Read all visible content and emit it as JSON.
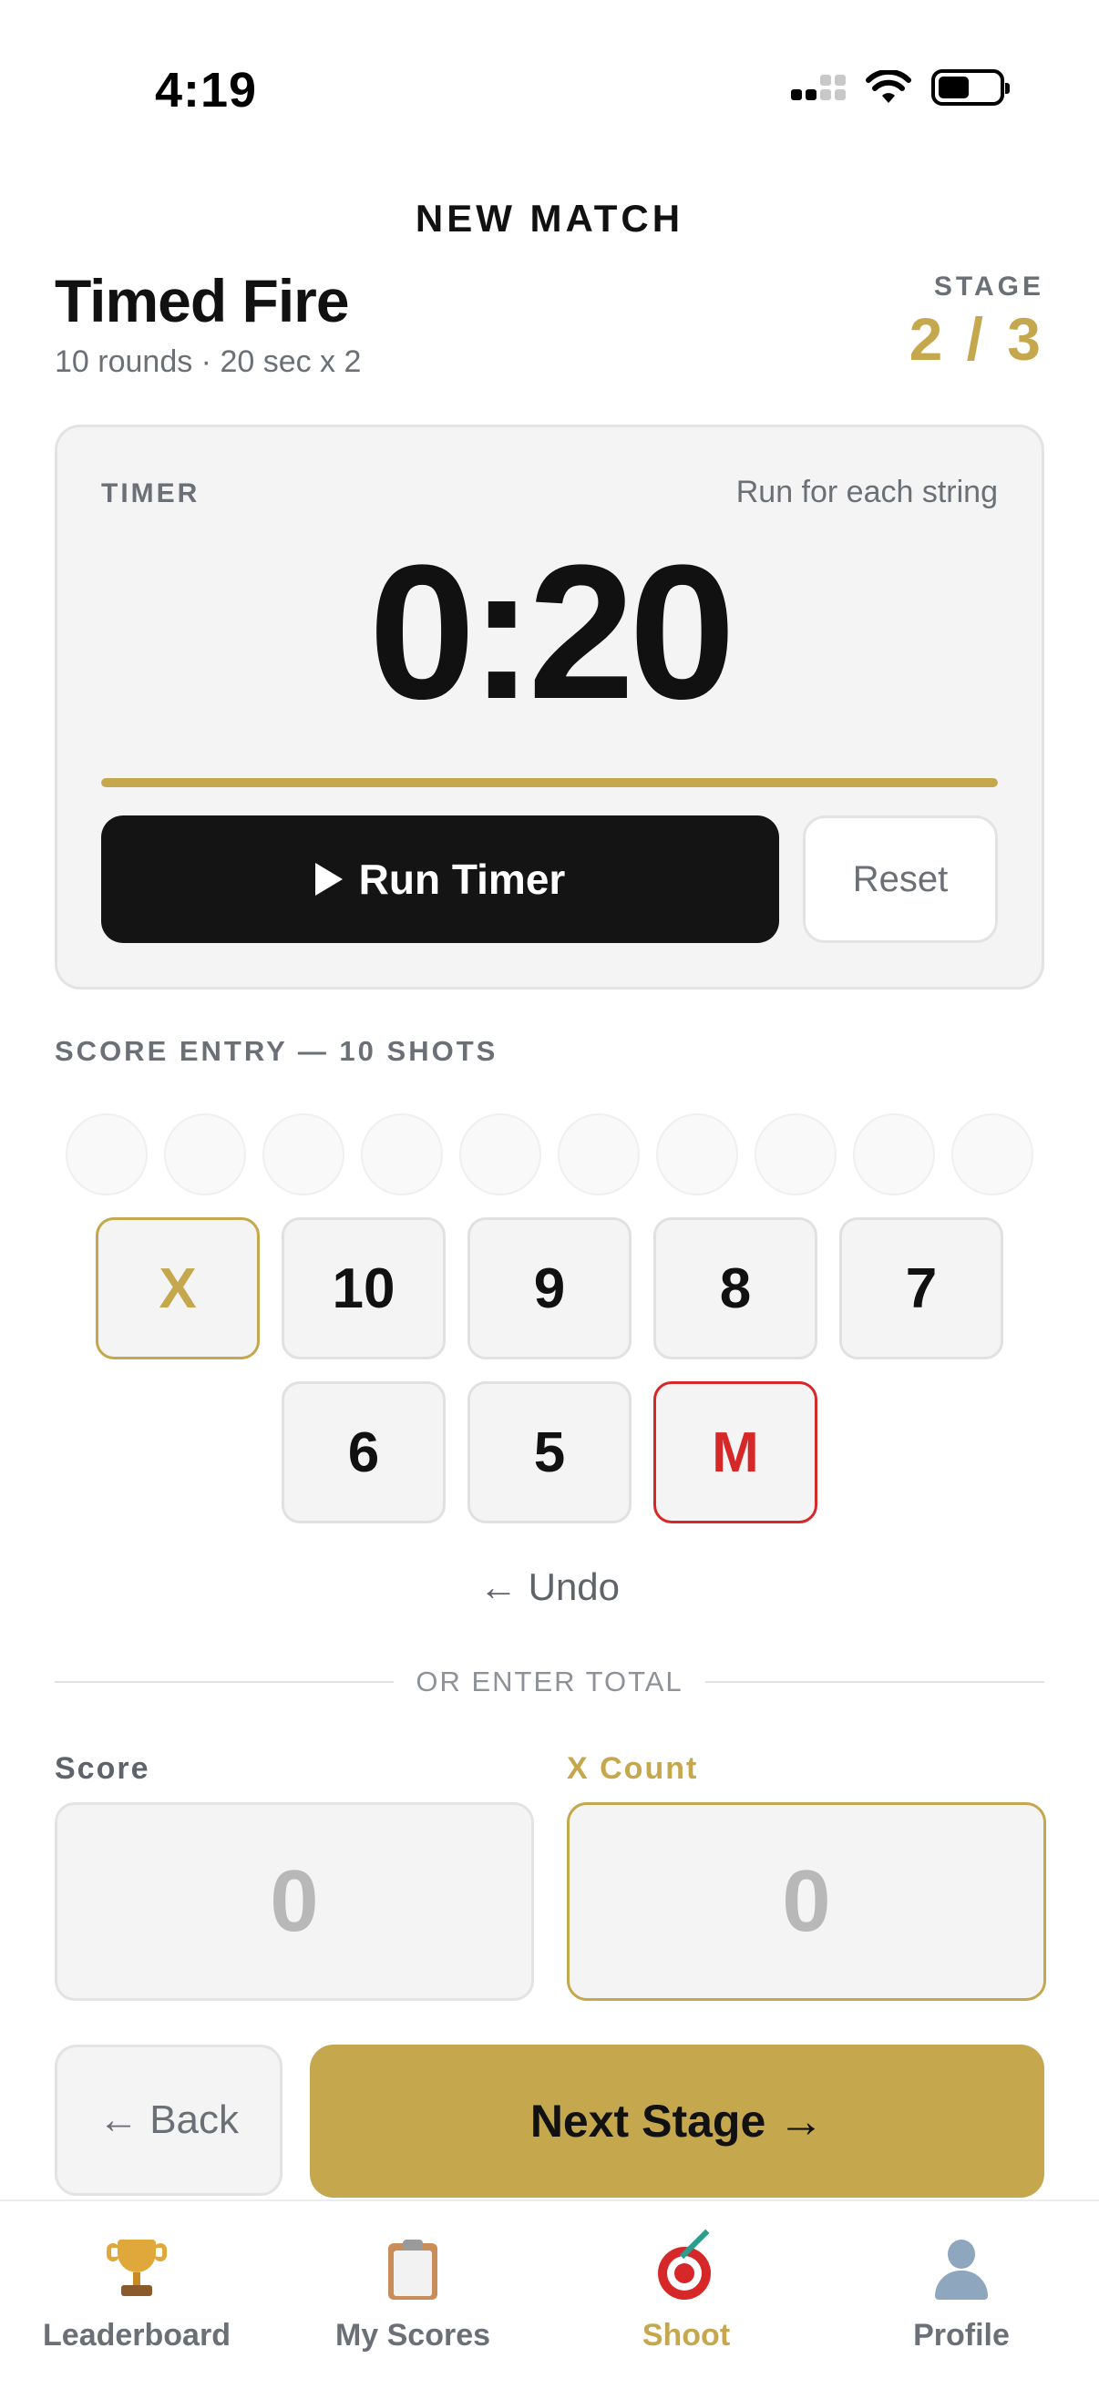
{
  "status_bar": {
    "time": "4:19"
  },
  "header": {
    "title": "NEW MATCH"
  },
  "stage": {
    "name": "Timed Fire",
    "subtitle": "10 rounds · 20 sec x 2",
    "label": "STAGE",
    "progress": "2 / 3"
  },
  "timer": {
    "label": "TIMER",
    "note": "Run for each string",
    "display": "0:20",
    "progress_fraction": 1.0,
    "run_label": "Run Timer",
    "reset_label": "Reset"
  },
  "score_entry": {
    "label": "SCORE ENTRY — 10 SHOTS",
    "shot_count": 10,
    "buttons": [
      "X",
      "10",
      "9",
      "8",
      "7",
      "6",
      "5",
      "M"
    ],
    "undo_label": "← Undo"
  },
  "total_entry": {
    "divider_label": "OR ENTER TOTAL",
    "score_label": "Score",
    "score_value": "0",
    "xcount_label": "X Count",
    "xcount_value": "0"
  },
  "actions": {
    "back_label": "← Back",
    "next_label": "Next Stage →"
  },
  "tab_bar": {
    "items": [
      {
        "label": "Leaderboard",
        "icon": "trophy-icon"
      },
      {
        "label": "My Scores",
        "icon": "clipboard-icon"
      },
      {
        "label": "Shoot",
        "icon": "target-icon",
        "active": true
      },
      {
        "label": "Profile",
        "icon": "person-icon"
      }
    ]
  },
  "colors": {
    "accent": "#c5a74e",
    "miss": "#d62828",
    "primary_button": "#141414"
  }
}
